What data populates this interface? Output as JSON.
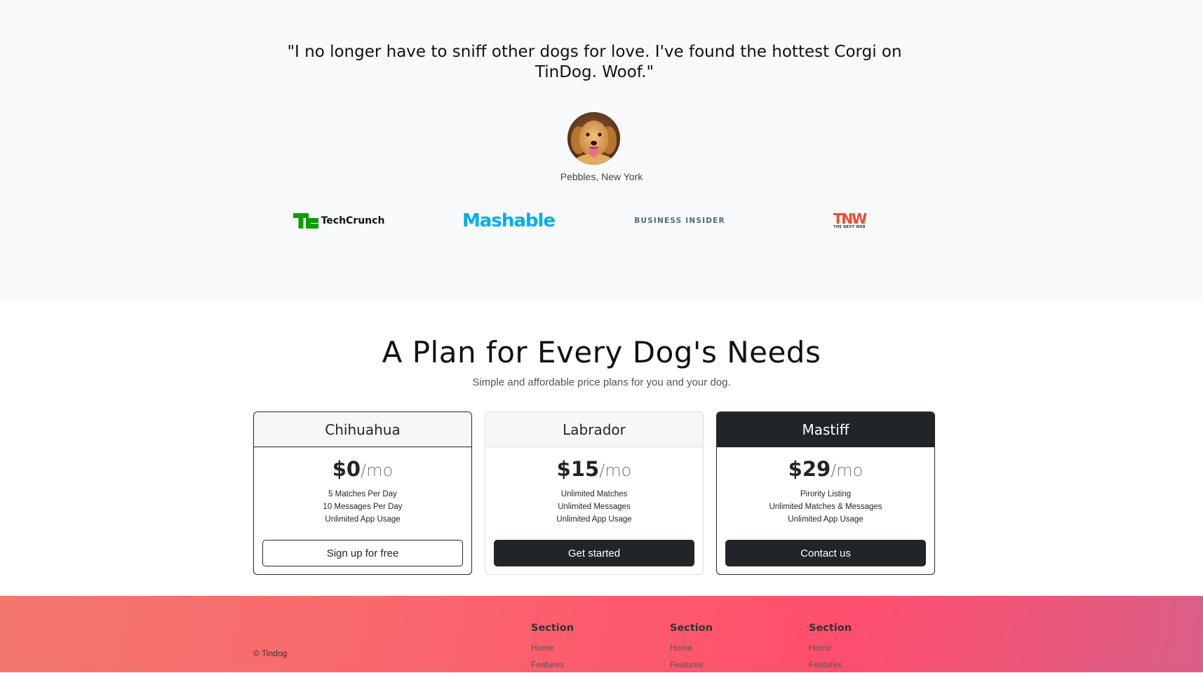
{
  "testimonial": {
    "quote": "\"I no longer have to sniff other dogs for love. I've found the hottest Corgi on TinDog. Woof.\"",
    "author": "Pebbles, New York"
  },
  "press": {
    "logos": [
      {
        "name": "TechCrunch",
        "icon": "techcrunch-logo",
        "color": "#0a9e01"
      },
      {
        "name": "Mashable",
        "icon": "mashable-logo",
        "color": "#00aeef"
      },
      {
        "name": "BUSINESS INSIDER",
        "icon": "business-insider-logo",
        "color": "#4a6b80"
      },
      {
        "name": "TNW",
        "subtitle": "THE NEXT WEB",
        "icon": "tnw-logo",
        "color": "#f2492e"
      }
    ]
  },
  "pricing": {
    "title": "A Plan for Every Dog's Needs",
    "subtitle": "Simple and affordable price plans for you and your dog.",
    "plans": [
      {
        "name": "Chihuahua",
        "price": "$0",
        "period": "/mo",
        "features": [
          "5 Matches Per Day",
          "10 Messages Per Day",
          "Unlimited App Usage"
        ],
        "button": "Sign up for free"
      },
      {
        "name": "Labrador",
        "price": "$15",
        "period": "/mo",
        "features": [
          "Unlimited Matches",
          "Unlimited Messages",
          "Unlimited App Usage"
        ],
        "button": "Get started"
      },
      {
        "name": "Mastiff",
        "price": "$29",
        "period": "/mo",
        "features": [
          "Pirority Listing",
          "Unlimited Matches & Messages",
          "Unlimited App Usage"
        ],
        "button": "Contact us"
      }
    ]
  },
  "footer": {
    "copyright": "© Tindog",
    "columns": [
      {
        "title": "Section",
        "links": [
          "Home",
          "Features"
        ]
      },
      {
        "title": "Section",
        "links": [
          "Home",
          "Features"
        ]
      },
      {
        "title": "Section",
        "links": [
          "Home",
          "Features"
        ]
      }
    ]
  },
  "colors": {
    "dark": "#212529",
    "light_bg": "#f8f9fa",
    "footer_gradient_start": "#f3766f",
    "footer_gradient_end": "#db5f87"
  }
}
